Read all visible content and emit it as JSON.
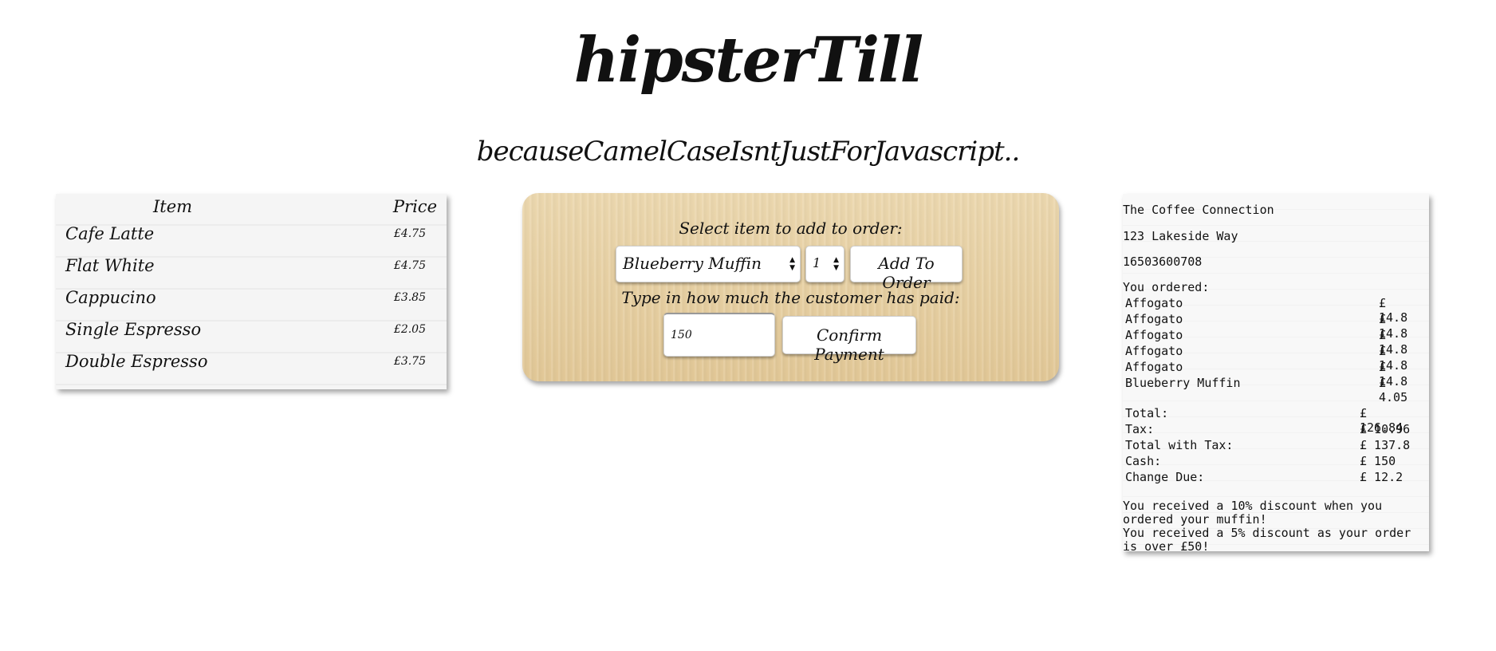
{
  "header": {
    "title": "hipsterTill",
    "tagline": "becauseCamelCaseIsntJustForJavascript.."
  },
  "menu": {
    "col_item": "Item",
    "col_price": "Price",
    "items": [
      {
        "name": "Cafe Latte",
        "price": "£4.75"
      },
      {
        "name": "Flat White",
        "price": "£4.75"
      },
      {
        "name": "Cappucino",
        "price": "£3.85"
      },
      {
        "name": "Single Espresso",
        "price": "£2.05"
      },
      {
        "name": "Double Espresso",
        "price": "£3.75"
      }
    ]
  },
  "order": {
    "select_label": "Select item to add to order:",
    "selected_item": "Blueberry Muffin",
    "quantity": "1",
    "add_button": "Add To Order",
    "paid_label": "Type in how much the customer has paid:",
    "paid_value": "150",
    "confirm_button": "Confirm Payment"
  },
  "receipt": {
    "shop_name": "The Coffee Connection",
    "address": "123 Lakeside Way",
    "phone": "16503600708",
    "ordered_label": "You ordered:",
    "lines": [
      {
        "item": "Affogato",
        "price": "£ 14.8"
      },
      {
        "item": "Affogato",
        "price": "£ 14.8"
      },
      {
        "item": "Affogato",
        "price": "£ 14.8"
      },
      {
        "item": "Affogato",
        "price": "£ 14.8"
      },
      {
        "item": "Affogato",
        "price": "£ 14.8"
      },
      {
        "item": "Blueberry Muffin",
        "price": "£ 4.05"
      }
    ],
    "totals": [
      {
        "label": "Total:",
        "value": "£ 126.84"
      },
      {
        "label": "Tax:",
        "value": "£ 10.96"
      },
      {
        "label": "Total with Tax:",
        "value": "£ 137.8"
      },
      {
        "label": "Cash:",
        "value": "£ 150"
      },
      {
        "label": "Change Due:",
        "value": "£ 12.2"
      }
    ],
    "discount_muffin": "You received a 10% discount when you ordered your muffin!",
    "discount_order": "You received a 5% discount as your order is over £50!"
  }
}
